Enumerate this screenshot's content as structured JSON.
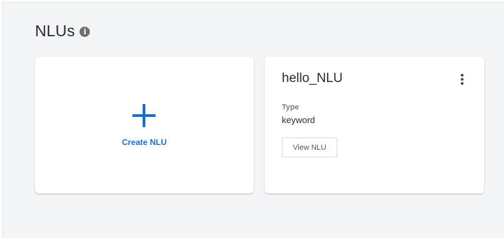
{
  "page": {
    "title": "NLUs",
    "info_icon": "info-icon"
  },
  "create_card": {
    "icon": "plus-icon",
    "label": "Create NLU",
    "accent_color": "#1a6fc4"
  },
  "nlu_cards": [
    {
      "name": "hello_NLU",
      "menu_icon": "kebab-menu-icon",
      "type_label": "Type",
      "type_value": "keyword",
      "view_button_label": "View NLU"
    }
  ]
}
